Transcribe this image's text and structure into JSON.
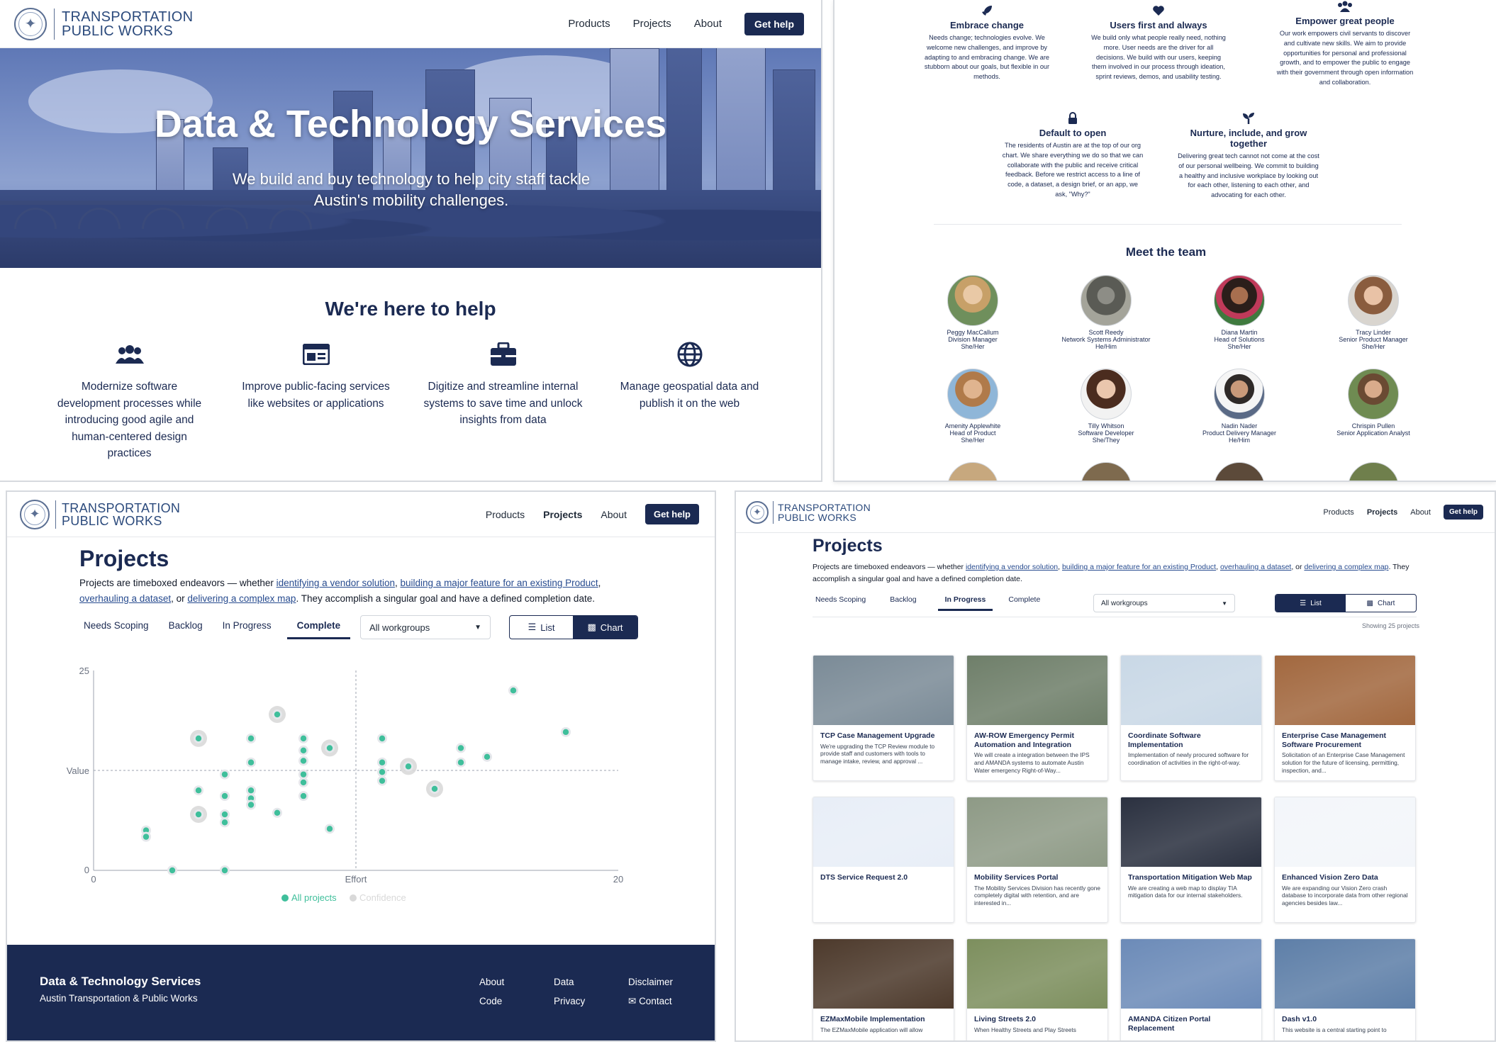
{
  "site": {
    "brand_line1": "TRANSPORTATION",
    "brand_line2": "PUBLIC WORKS",
    "nav": [
      "Products",
      "Projects",
      "About"
    ],
    "cta": "Get help"
  },
  "home": {
    "hero_title": "Data & Technology Services",
    "hero_subtitle": "We build and buy technology to help city staff tackle Austin's mobility challenges.",
    "help_title": "We're here to help",
    "help_items": [
      {
        "icon": "people-icon",
        "text": "Modernize software development processes while introducing good agile and human-centered design practices"
      },
      {
        "icon": "browser-window-icon",
        "text": "Improve public-facing services like websites or applications"
      },
      {
        "icon": "briefcase-icon",
        "text": "Digitize and streamline internal systems to save time and unlock insights from data"
      },
      {
        "icon": "globe-icon",
        "text": "Manage geospatial data and publish it on the web"
      }
    ]
  },
  "about": {
    "values": [
      {
        "icon": "rocket-icon",
        "title": "Embrace change",
        "text": "Needs change; technologies evolve. We welcome new challenges, and improve by adapting to and embracing change. We are stubborn about our goals, but flexible in our methods."
      },
      {
        "icon": "heart-icon",
        "title": "Users first and always",
        "text": "We build only what people really need, nothing more. User needs are the driver for all decisions. We build with our users, keeping them involved in our process through ideation, sprint reviews, demos, and usability testing."
      },
      {
        "icon": "people-icon",
        "title": "Empower great people",
        "text": "Our work empowers civil servants to discover and cultivate new skills. We aim to provide opportunities for personal and professional growth, and to empower the public to engage with their government through open information and collaboration."
      },
      {
        "icon": "lock-icon",
        "title": "Default to open",
        "text": "The residents of Austin are at the top of our org chart. We share everything we do so that we can collaborate with the public and receive critical feedback. Before we restrict access to a line of code, a dataset, a design brief, or an app, we ask, \"Why?\""
      },
      {
        "icon": "seedling-icon",
        "title": "Nurture, include, and grow together",
        "text": "Delivering great tech cannot not come at the cost of our personal wellbeing. We commit to building a healthy and inclusive workplace by looking out for each other, listening to each other, and advocating for each other."
      }
    ],
    "team_title": "Meet the team",
    "team": [
      {
        "name": "Peggy MacCallum",
        "role": "Division Manager",
        "pronouns": "She/Her"
      },
      {
        "name": "Scott Reedy",
        "role": "Network Systems Administrator",
        "pronouns": "He/Him"
      },
      {
        "name": "Diana Martin",
        "role": "Head of Solutions",
        "pronouns": "She/Her"
      },
      {
        "name": "Tracy Linder",
        "role": "Senior Product Manager",
        "pronouns": "She/Her"
      },
      {
        "name": "Amenity Applewhite",
        "role": "Head of Product",
        "pronouns": "She/Her"
      },
      {
        "name": "Tilly Whitson",
        "role": "Software Developer",
        "pronouns": "She/They"
      },
      {
        "name": "Nadin Nader",
        "role": "Product Delivery Manager",
        "pronouns": "He/Him"
      },
      {
        "name": "Chrispin Pullen",
        "role": "Senior Application Analyst",
        "pronouns": ""
      }
    ]
  },
  "projects": {
    "title": "Projects",
    "desc_before": "Projects are timeboxed endeavors — whether ",
    "link1": "identifying a vendor solution",
    "sep1": ", ",
    "link2": "building a major feature for an existing Product",
    "sep2": ", ",
    "link3": "overhauling a dataset",
    "sep3": ", or ",
    "link4": "delivering a complex map",
    "desc_after": ". They accomplish a singular goal and have a defined completion date.",
    "tabs": [
      "Needs Scoping",
      "Backlog",
      "In Progress",
      "Complete"
    ],
    "workgroup_select": "All workgroups",
    "view_list": "List",
    "view_chart": "Chart",
    "showing": "Showing 25 projects"
  },
  "chart_view": {
    "active_tab": "Complete",
    "active_view": "Chart"
  },
  "list_view": {
    "active_tab": "In Progress",
    "active_view": "List",
    "cards": [
      {
        "title": "TCP Case Management Upgrade",
        "text": "We're upgrading the TCP Review module to provide staff and customers with tools to manage intake, review, and approval ...",
        "theme": "#7b8b97"
      },
      {
        "title": "AW-ROW Emergency Permit Automation and Integration",
        "text": "We will create a integration between the IPS and AMANDA systems to automate Austin Water emergency Right-of-Way...",
        "theme": "#6f7f6a"
      },
      {
        "title": "Coordinate Software Implementation",
        "text": "Implementation of newly procured software for coordination of activities in the right-of-way.",
        "theme": "#c9d8e6"
      },
      {
        "title": "Enterprise Case Management Software Procurement",
        "text": "Solicitation of an Enterprise Case Management solution for the future of licensing, permitting, inspection, and...",
        "theme": "#a2683f"
      },
      {
        "title": "DTS Service Request 2.0",
        "text": "",
        "theme": "#e8eef7"
      },
      {
        "title": "Mobility Services Portal",
        "text": "The Mobility Services Division has recently gone completely digital with retention, and are interested in...",
        "theme": "#8e9a86"
      },
      {
        "title": "Transportation Mitigation Web Map",
        "text": "We are creating a web map to display TIA mitigation data for our internal stakeholders.",
        "theme": "#2b3140"
      },
      {
        "title": "Enhanced Vision Zero Data",
        "text": "We are expanding our Vision Zero crash database to incorporate data from other regional agencies besides law...",
        "theme": "#f3f6fa"
      },
      {
        "title": "EZMaxMobile Implementation",
        "text": "The EZMaxMobile application will allow",
        "theme": "#4d3a2c"
      },
      {
        "title": "Living Streets 2.0",
        "text": "When Healthy Streets and Play Streets",
        "theme": "#7d8f5e"
      },
      {
        "title": "AMANDA Citizen Portal Replacement",
        "text": "",
        "theme": "#6c8bb8"
      },
      {
        "title": "Dash v1.0",
        "text": "This website is a central starting point to",
        "theme": "#5e7fa8"
      }
    ]
  },
  "footer": {
    "title": "Data & Technology Services",
    "subtitle": "Austin Transportation & Public Works",
    "links": [
      "About",
      "Data",
      "Disclaimer",
      "Code",
      "Privacy",
      "Contact"
    ]
  },
  "chart_data": {
    "type": "scatter",
    "title": "",
    "xlabel": "Effort",
    "ylabel": "Value",
    "xlim": [
      0,
      20
    ],
    "ylim": [
      0,
      25
    ],
    "x_ticks": [
      "0",
      "20"
    ],
    "y_ticks": [
      "0",
      "25"
    ],
    "reference_lines": {
      "x": 10,
      "y": 12.5
    },
    "legend": {
      "placement": "bottom",
      "items": [
        "All projects",
        "Confidence"
      ]
    },
    "colors": {
      "point": "#3fbf9b",
      "confidence": "#d9d9d9",
      "axis": "#6b7280"
    },
    "series": [
      {
        "name": "All projects",
        "points": [
          {
            "x": 2,
            "y": 5.0
          },
          {
            "x": 2,
            "y": 4.2
          },
          {
            "x": 3,
            "y": 0
          },
          {
            "x": 4,
            "y": 16.5
          },
          {
            "x": 4,
            "y": 10.0
          },
          {
            "x": 4,
            "y": 7.0
          },
          {
            "x": 5,
            "y": 12.0
          },
          {
            "x": 5,
            "y": 9.3
          },
          {
            "x": 5,
            "y": 7.0
          },
          {
            "x": 5,
            "y": 6.0
          },
          {
            "x": 5,
            "y": 0
          },
          {
            "x": 6,
            "y": 16.5
          },
          {
            "x": 6,
            "y": 13.5
          },
          {
            "x": 6,
            "y": 10.0
          },
          {
            "x": 6,
            "y": 9.0
          },
          {
            "x": 6,
            "y": 8.2
          },
          {
            "x": 7,
            "y": 19.5
          },
          {
            "x": 7,
            "y": 7.2
          },
          {
            "x": 8,
            "y": 16.5
          },
          {
            "x": 8,
            "y": 15.0
          },
          {
            "x": 8,
            "y": 13.7
          },
          {
            "x": 8,
            "y": 12.0
          },
          {
            "x": 8,
            "y": 11.0
          },
          {
            "x": 8,
            "y": 9.3
          },
          {
            "x": 9,
            "y": 15.3
          },
          {
            "x": 9,
            "y": 5.2
          },
          {
            "x": 11,
            "y": 16.5
          },
          {
            "x": 11,
            "y": 13.5
          },
          {
            "x": 11,
            "y": 12.3
          },
          {
            "x": 11,
            "y": 11.2
          },
          {
            "x": 12,
            "y": 13.0
          },
          {
            "x": 13,
            "y": 10.2
          },
          {
            "x": 14,
            "y": 15.3
          },
          {
            "x": 14,
            "y": 13.5
          },
          {
            "x": 15,
            "y": 14.2
          },
          {
            "x": 16,
            "y": 22.5
          },
          {
            "x": 18,
            "y": 17.3
          }
        ]
      },
      {
        "name": "Confidence",
        "points": [
          {
            "x": 4,
            "y": 16.5
          },
          {
            "x": 4,
            "y": 7.0
          },
          {
            "x": 7,
            "y": 19.5
          },
          {
            "x": 9,
            "y": 15.3
          },
          {
            "x": 12,
            "y": 13.0
          },
          {
            "x": 13,
            "y": 10.2
          }
        ]
      }
    ]
  }
}
